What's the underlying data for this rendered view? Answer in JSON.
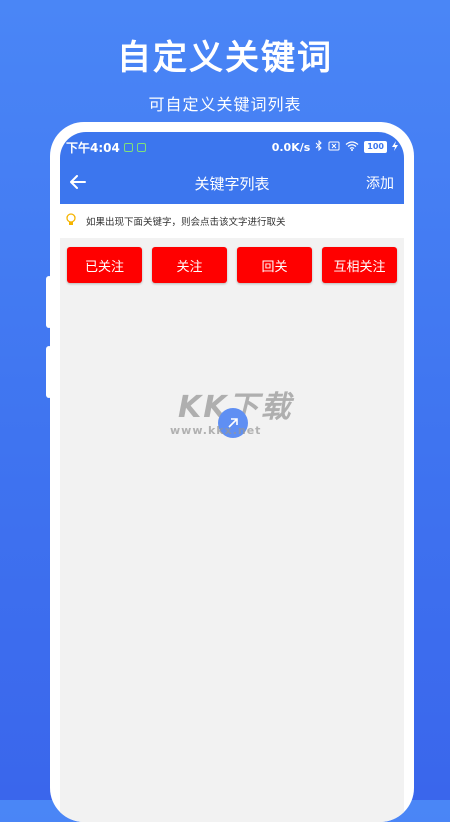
{
  "hero": {
    "title": "自定义关键词",
    "subtitle": "可自定义关键词列表"
  },
  "status_bar": {
    "time": "下午4:04",
    "network_speed": "0.0K/s",
    "battery": "100"
  },
  "app_bar": {
    "back_icon": "arrow-left-icon",
    "title": "关键字列表",
    "action_label": "添加"
  },
  "tip": {
    "icon": "lightbulb-icon",
    "text": "如果出现下面关键字，则会点击该文字进行取关"
  },
  "keyword_buttons": [
    "已关注",
    "关注",
    "回关",
    "互相关注"
  ],
  "watermark": {
    "text": "KK下载",
    "url": "www.kkx.net"
  },
  "colors": {
    "primary": "#3c76ee",
    "button_red": "#ff0000",
    "content_bg": "#f2f2f2"
  }
}
